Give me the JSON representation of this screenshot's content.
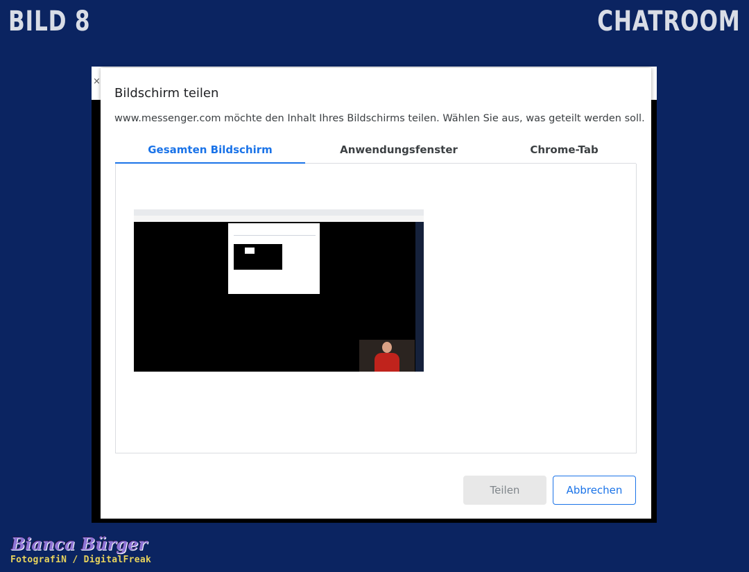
{
  "overlay": {
    "label_left": "BILD 8",
    "label_right": "CHATROOM"
  },
  "background_window": {
    "close_glyph": "×"
  },
  "dialog": {
    "title": "Bildschirm teilen",
    "description": "www.messenger.com möchte den Inhalt Ihres Bildschirms teilen. Wählen Sie aus, was geteilt werden soll.",
    "tabs": [
      {
        "label": "Gesamten Bildschirm",
        "active": true
      },
      {
        "label": "Anwendungsfenster",
        "active": false
      },
      {
        "label": "Chrome-Tab",
        "active": false
      }
    ],
    "buttons": {
      "share": "Teilen",
      "cancel": "Abbrechen"
    }
  },
  "credit": {
    "name": "Bianca Bürger",
    "subtitle": "FotografiN / DigitalFreak"
  },
  "colors": {
    "background": "#0b2461",
    "accent_blue": "#1a73e8",
    "disabled_button": "#e8e8e8"
  }
}
